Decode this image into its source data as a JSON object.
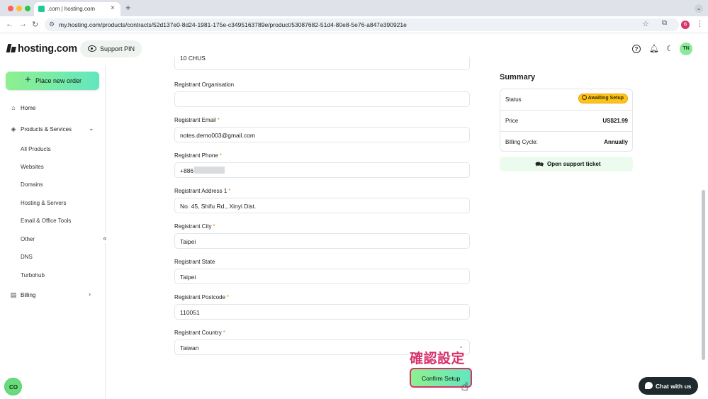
{
  "browser": {
    "tab_title": ".com | hosting.com",
    "url": "my.hosting.com/products/contracts/52d137e0-8d24-1981-175e-c3495163789e/product/53087682-51d4-80e8-5e76-a847e390921e",
    "profile_initials": "G",
    "new_tab_symbol": "+",
    "close_symbol": "×"
  },
  "header": {
    "logo_text": "hosting.com",
    "support_pin_label": "Support PIN",
    "avatar_initials": "TN"
  },
  "sidebar": {
    "place_order_label": "Place new order",
    "home": "Home",
    "products_services": "Products & Services",
    "sub_items": [
      "All Products",
      "Websites",
      "Domains",
      "Hosting & Servers",
      "Email & Office Tools",
      "Other",
      "DNS",
      "Turbohub"
    ],
    "billing": "Billing",
    "collapse_symbol": "«",
    "bottom_button_label": "CO"
  },
  "form": {
    "clipped_value": "10 CHUS",
    "fields": [
      {
        "label": "Registrant Organisation",
        "required": false,
        "value": ""
      },
      {
        "label": "Registrant Email",
        "required": true,
        "value": "notes.demo003@gmail.com"
      },
      {
        "label": "Registrant Phone",
        "required": true,
        "value": "+886"
      },
      {
        "label": "Registrant Address 1",
        "required": true,
        "value": "No. 45, Shifu Rd., Xinyi Dist."
      },
      {
        "label": "Registrant City",
        "required": true,
        "value": "Taipei"
      },
      {
        "label": "Registrant State",
        "required": false,
        "value": "Taipei"
      },
      {
        "label": "Registrant Postcode",
        "required": true,
        "value": "110051"
      },
      {
        "label": "Registrant Country",
        "required": true,
        "value": "Taiwan"
      }
    ],
    "required_mark": "*"
  },
  "summary": {
    "title": "Summary",
    "status_key": "Status",
    "status_value": "Awaiting Setup",
    "price_key": "Price",
    "price_value": "US$21.99",
    "billing_key": "Billing Cycle:",
    "billing_value": "Annually",
    "support_ticket_label": "Open support ticket"
  },
  "confirm": {
    "annotation": "確認設定",
    "button_label": "Confirm Setup"
  },
  "chat": {
    "label": "Chat with us"
  },
  "colors": {
    "accent_green": "#69db7c",
    "status_yellow": "#fcc419",
    "annotation_pink": "#d6336c"
  }
}
